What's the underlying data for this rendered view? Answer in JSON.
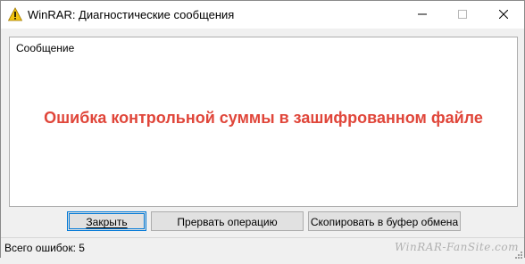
{
  "window": {
    "title": "WinRAR: Диагностические сообщения",
    "icon": "warning-icon"
  },
  "controls": {
    "minimize_icon": "minimize-icon",
    "maximize_icon": "maximize-icon",
    "close_icon": "close-icon"
  },
  "list": {
    "column_header": "Сообщение",
    "message": "Ошибка контрольной суммы в зашифрованном файле"
  },
  "buttons": {
    "close": "Закрыть",
    "abort": "Прервать операцию",
    "copy": "Скопировать в буфер обмена"
  },
  "status": {
    "errors_total": "Всего ошибок: 5",
    "watermark": "WinRAR-FanSite.com"
  },
  "colors": {
    "error_text": "#e0463a",
    "focus_border": "#0078d7",
    "warning_yellow": "#f2c40f"
  }
}
